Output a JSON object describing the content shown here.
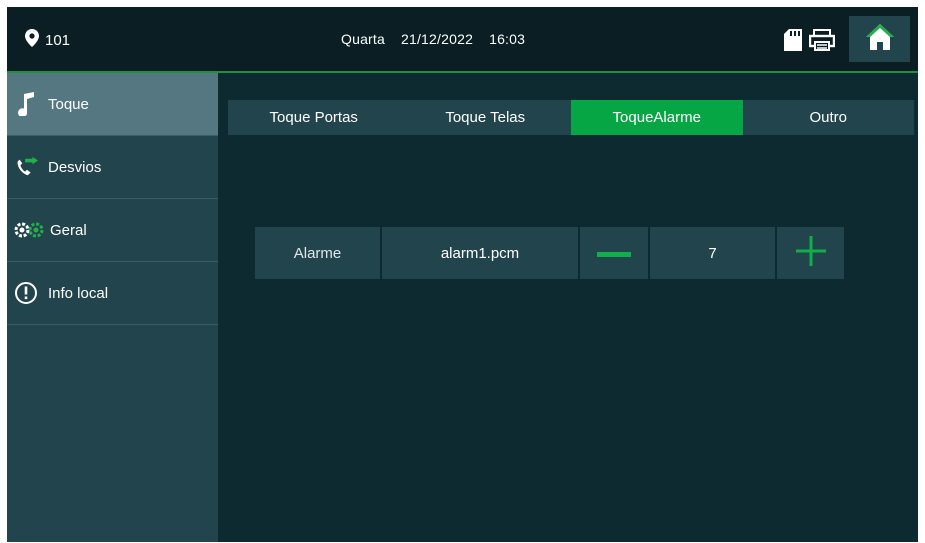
{
  "header": {
    "location": "101",
    "day": "Quarta",
    "date": "21/12/2022",
    "time": "16:03",
    "icons": [
      "location-pin-icon",
      "sd-card-icon",
      "printer-icon",
      "home-icon"
    ]
  },
  "sidebar": {
    "items": [
      {
        "label": "Toque",
        "icon": "music-note-icon",
        "active": true
      },
      {
        "label": "Desvios",
        "icon": "phone-forward-icon"
      },
      {
        "label": "Geral",
        "icon": "gears-icon"
      },
      {
        "label": "Info local",
        "icon": "info-exclamation-icon"
      }
    ]
  },
  "tabs": [
    {
      "label": "Toque Portas"
    },
    {
      "label": "Toque Telas"
    },
    {
      "label": "ToqueAlarme",
      "active": true
    },
    {
      "label": "Outro"
    }
  ],
  "alarm_row": {
    "label": "Alarme",
    "file": "alarm1.pcm",
    "volume": "7",
    "minus_icon": "minus-icon",
    "plus_icon": "plus-icon"
  },
  "colors": {
    "background": "#0e2a31",
    "topbar": "#0a1e23",
    "panel": "#22444c",
    "active_sidebar": "#557781",
    "accent_green": "#07a644",
    "icon_green": "#23b04b"
  }
}
